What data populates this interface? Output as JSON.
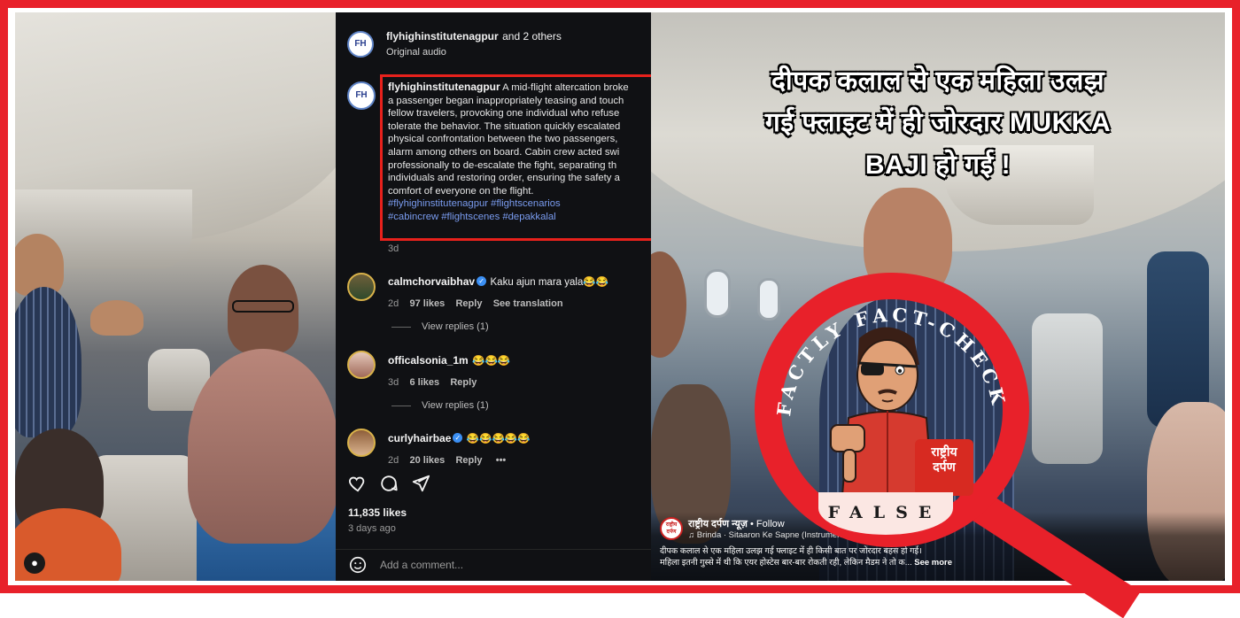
{
  "instagram": {
    "header": {
      "account": "flyhighinstitutenagpur",
      "and_others": "and 2 others",
      "audio": "Original audio",
      "avatar_text": "FH"
    },
    "caption": {
      "author": "flyhighinstitutenagpur",
      "lines": [
        "A mid-flight altercation broke",
        "a passenger began inappropriately teasing and touch",
        "fellow travelers, provoking one individual who refuse",
        "tolerate the behavior. The situation quickly escalated",
        "physical confrontation between the two passengers,",
        "alarm among others on board. Cabin crew acted swi",
        "professionally to de-escalate the fight, separating th",
        "individuals and restoring order, ensuring the safety a",
        "comfort of everyone on the flight."
      ],
      "hashtags_line1": "#flyhighinstitutenagpur #flightscenarios",
      "hashtags_line2": "#cabincrew #flightscenes #depakkalal",
      "age": "3d"
    },
    "comments": [
      {
        "user": "calmchorvaibhav",
        "verified": true,
        "text": "Kaku ajun mara yala😂😂",
        "age": "2d",
        "likes": "97 likes",
        "reply": "Reply",
        "translate": "See translation",
        "view_replies": "View replies (1)"
      },
      {
        "user": "officalsonia_1m",
        "verified": false,
        "text": "😂😂😂",
        "age": "3d",
        "likes": "6 likes",
        "reply": "Reply",
        "view_replies": "View replies (1)"
      },
      {
        "user": "curlyhairbae",
        "verified": true,
        "text": "😂😂😂😂😂",
        "age": "2d",
        "likes": "20 likes",
        "reply": "Reply",
        "more": "•••"
      }
    ],
    "likes_total": "11,835 likes",
    "posted": "3 days ago",
    "add_comment_placeholder": "Add a comment..."
  },
  "right_video": {
    "title_line1": "दीपक कलाल से एक महिला उलझ",
    "title_line2": "गई फ्लाइट में ही जोरदार MUKKA",
    "title_line3": "BAJI हो गई !",
    "page_name": "राष्ट्रीय दर्पण न्यूज़",
    "follow": "• Follow",
    "song": "♫ Brinda · Sitaaron Ke Sapne (Instrument",
    "caption_line1": "दीपक कलाल से एक महिला उलझ गई फ्लाइट में ही किसी बात पर जोरदार बहस हो गई।",
    "caption_line2": "महिला इतनी गुस्से में थी कि एयर होस्टेस बार-बार रोकती रही, लेकिन मैडम ने तो क...",
    "see_more": "See more",
    "rd_logo_line1": "राष्ट्रीय",
    "rd_logo_line2": "दर्पण",
    "avatar_text": "राष्ट्रीय दर्पण"
  },
  "stamp": {
    "ring_text": "FACTLY FACT-CHECK",
    "verdict": "FALSE",
    "color": "#e8212a"
  }
}
